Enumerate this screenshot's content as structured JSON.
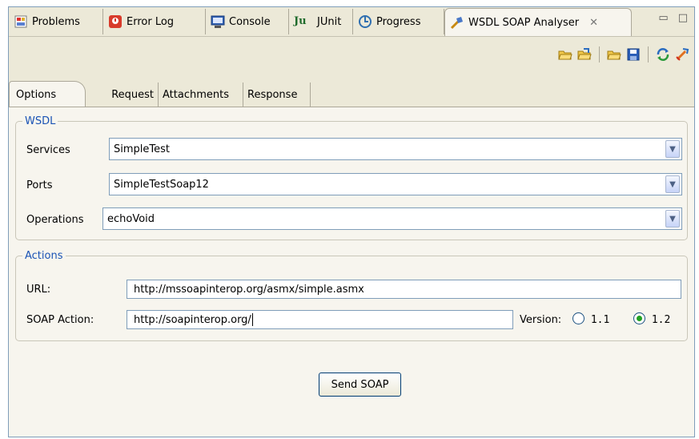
{
  "view_tabs": [
    {
      "label": "Problems",
      "icon": "problems-icon"
    },
    {
      "label": "Error Log",
      "icon": "error-log-icon"
    },
    {
      "label": "Console",
      "icon": "console-icon"
    },
    {
      "label": "JUnit",
      "icon": "junit-icon"
    },
    {
      "label": "Progress",
      "icon": "progress-icon"
    },
    {
      "label": "WSDL SOAP Analyser",
      "icon": "wsdl-analyser-icon",
      "active": true
    }
  ],
  "toolbar_icons": [
    "open-folder-icon",
    "open-file-icon",
    "load-folder-icon",
    "save-icon",
    "refresh-icon",
    "clear-icon"
  ],
  "inner_tabs": [
    "Options",
    "Request",
    "Attachments",
    "Response"
  ],
  "wsdl": {
    "legend": "WSDL",
    "services_label": "Services",
    "services_value": "SimpleTest",
    "ports_label": "Ports",
    "ports_value": "SimpleTestSoap12",
    "operations_label": "Operations",
    "operations_value": "echoVoid"
  },
  "actions": {
    "legend": "Actions",
    "url_label": "URL:",
    "url_value": "http://mssoapinterop.org/asmx/simple.asmx",
    "soap_action_label": "SOAP Action:",
    "soap_action_value": "http://soapinterop.org/",
    "version_label": "Version:",
    "version_11": "1.1",
    "version_12": "1.2",
    "selected_version": "1.2"
  },
  "send_button": "Send SOAP",
  "colors": {
    "legend": "#1a53b5",
    "border": "#7f9db9"
  }
}
